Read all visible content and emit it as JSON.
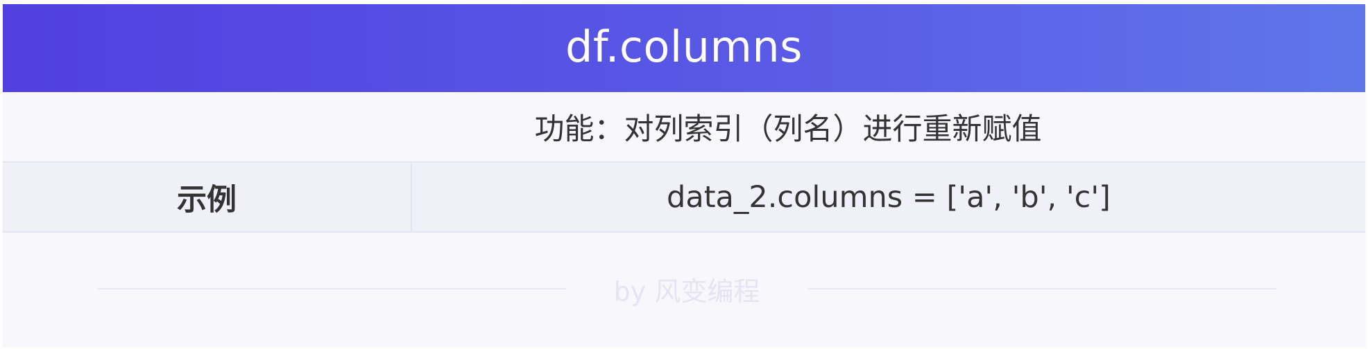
{
  "header": {
    "title": "df.columns"
  },
  "description": {
    "text": "功能：对列索引（列名）进行重新赋值"
  },
  "example": {
    "label": "示例",
    "code": "data_2.columns = ['a', 'b', 'c']"
  },
  "footer": {
    "watermark": "by 风变编程"
  },
  "colors": {
    "header_gradient_start": "#5040e0",
    "header_gradient_end": "#5f76ea",
    "card_background": "#f7f7fc",
    "example_row_background": "#f0f0f9",
    "text": "#333333",
    "watermark": "#e4e4f3"
  }
}
